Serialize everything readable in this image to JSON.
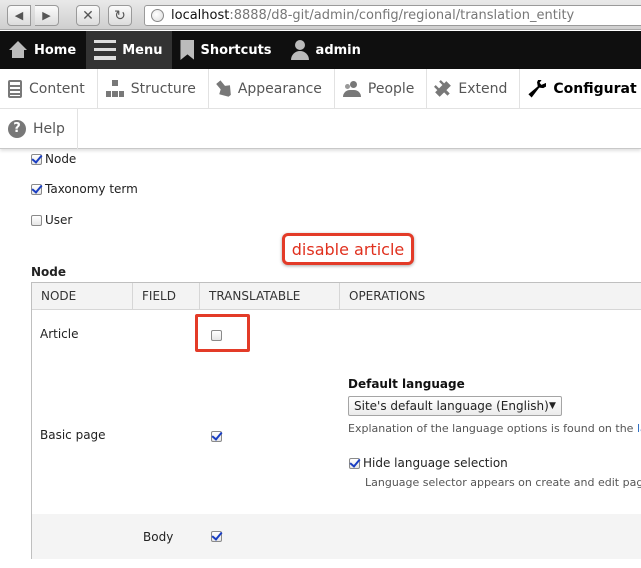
{
  "browser": {
    "url_host": "localhost",
    "url_path": ":8888/d8-git/admin/config/regional/translation_entity"
  },
  "toolbar": {
    "home": "Home",
    "menu": "Menu",
    "shortcuts": "Shortcuts",
    "user": "admin"
  },
  "tray": {
    "items": [
      "Content",
      "Structure",
      "Appearance",
      "People",
      "Extend",
      "Configurat",
      "Help"
    ]
  },
  "entity_types": [
    {
      "label": "Node",
      "checked": true
    },
    {
      "label": "Taxonomy term",
      "checked": true
    },
    {
      "label": "User",
      "checked": false
    }
  ],
  "annotation": "disable article",
  "section_title": "Node",
  "table": {
    "headers": [
      "NODE",
      "FIELD",
      "TRANSLATABLE",
      "OPERATIONS"
    ],
    "rows": [
      {
        "node": "Article",
        "field": "",
        "translatable": false
      },
      {
        "node": "Basic page",
        "field": "",
        "translatable": true
      },
      {
        "node": "",
        "field": "Body",
        "translatable": true
      }
    ]
  },
  "operations": {
    "default_language_label": "Default language",
    "default_language_value": "Site's default language (English)",
    "explanation_prefix": "Explanation of the language options is found on the ",
    "explanation_link": "la",
    "hide_selection_label": "Hide language selection",
    "hide_selection_checked": true,
    "selector_desc": "Language selector appears on create and edit pages"
  }
}
